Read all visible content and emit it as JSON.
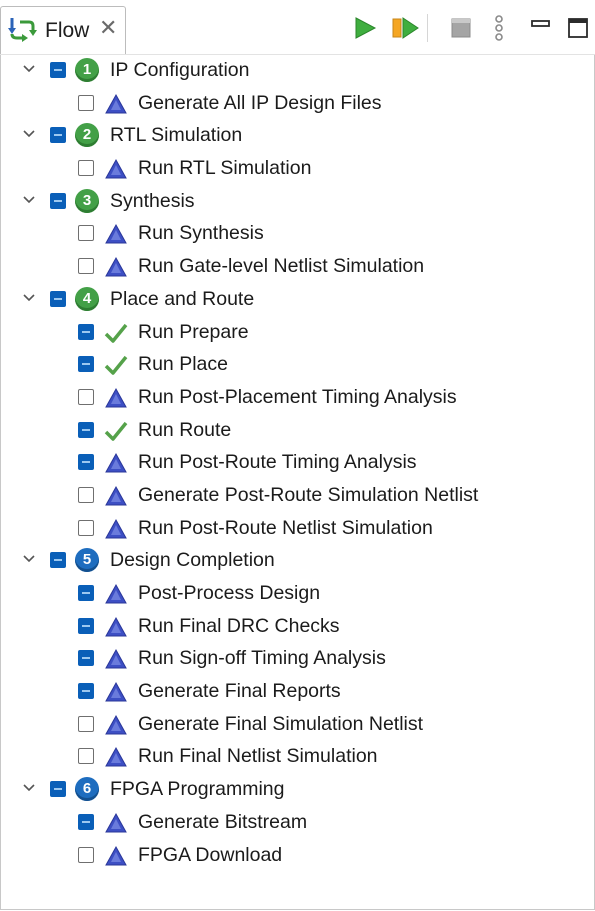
{
  "panel": {
    "tab_title": "Flow",
    "tab_icon": "flow-arrows-icon",
    "close_glyph": "✕",
    "toolbar": [
      {
        "name": "run-icon",
        "color": "#3fae3f"
      },
      {
        "name": "run-next-icon",
        "color": "#f5a623"
      },
      {
        "name": "stop-icon",
        "color": "#9e9e9e"
      },
      {
        "name": "view-menu-icon",
        "color": "#8a8a8a"
      },
      {
        "name": "minimize-icon",
        "color": "#2b2b2b"
      },
      {
        "name": "maximize-icon",
        "color": "#2b2b2b"
      }
    ]
  },
  "colors": {
    "checkbox_checked": "#0a5fb8",
    "badge_green": "#43a047",
    "badge_blue": "#1e6dbf",
    "task_triangle": "#3d4fc4",
    "done_check": "#55a24a"
  },
  "tree": [
    {
      "label": "IP Configuration",
      "number": "1",
      "badge_color": "green",
      "checked": true,
      "expanded": true,
      "children": [
        {
          "label": "Generate All IP Design Files",
          "checked": false,
          "status_icon": "triangle-icon"
        }
      ]
    },
    {
      "label": "RTL Simulation",
      "number": "2",
      "badge_color": "green",
      "checked": true,
      "expanded": true,
      "children": [
        {
          "label": "Run RTL Simulation",
          "checked": false,
          "status_icon": "triangle-icon"
        }
      ]
    },
    {
      "label": "Synthesis",
      "number": "3",
      "badge_color": "green",
      "checked": true,
      "expanded": true,
      "children": [
        {
          "label": "Run Synthesis",
          "checked": false,
          "status_icon": "triangle-icon"
        },
        {
          "label": "Run Gate-level Netlist Simulation",
          "checked": false,
          "status_icon": "triangle-icon"
        }
      ]
    },
    {
      "label": "Place and Route",
      "number": "4",
      "badge_color": "green",
      "checked": true,
      "expanded": true,
      "children": [
        {
          "label": "Run Prepare",
          "checked": true,
          "status_icon": "checkmark-icon"
        },
        {
          "label": "Run Place",
          "checked": true,
          "status_icon": "checkmark-icon"
        },
        {
          "label": "Run Post-Placement Timing Analysis",
          "checked": false,
          "status_icon": "triangle-icon"
        },
        {
          "label": "Run Route",
          "checked": true,
          "status_icon": "checkmark-icon"
        },
        {
          "label": "Run Post-Route Timing Analysis",
          "checked": true,
          "status_icon": "triangle-icon"
        },
        {
          "label": "Generate Post-Route Simulation Netlist",
          "checked": false,
          "status_icon": "triangle-icon"
        },
        {
          "label": "Run Post-Route Netlist Simulation",
          "checked": false,
          "status_icon": "triangle-icon"
        }
      ]
    },
    {
      "label": "Design Completion",
      "number": "5",
      "badge_color": "blue",
      "checked": true,
      "expanded": true,
      "children": [
        {
          "label": "Post-Process Design",
          "checked": true,
          "status_icon": "triangle-icon"
        },
        {
          "label": "Run Final DRC Checks",
          "checked": true,
          "status_icon": "triangle-icon"
        },
        {
          "label": "Run Sign-off Timing Analysis",
          "checked": true,
          "status_icon": "triangle-icon"
        },
        {
          "label": "Generate Final Reports",
          "checked": true,
          "status_icon": "triangle-icon"
        },
        {
          "label": "Generate Final Simulation Netlist",
          "checked": false,
          "status_icon": "triangle-icon"
        },
        {
          "label": "Run Final Netlist Simulation",
          "checked": false,
          "status_icon": "triangle-icon"
        }
      ]
    },
    {
      "label": "FPGA Programming",
      "number": "6",
      "badge_color": "blue",
      "checked": true,
      "expanded": true,
      "children": [
        {
          "label": "Generate Bitstream",
          "checked": true,
          "status_icon": "triangle-icon"
        },
        {
          "label": "FPGA Download",
          "checked": false,
          "status_icon": "triangle-icon"
        }
      ]
    }
  ]
}
